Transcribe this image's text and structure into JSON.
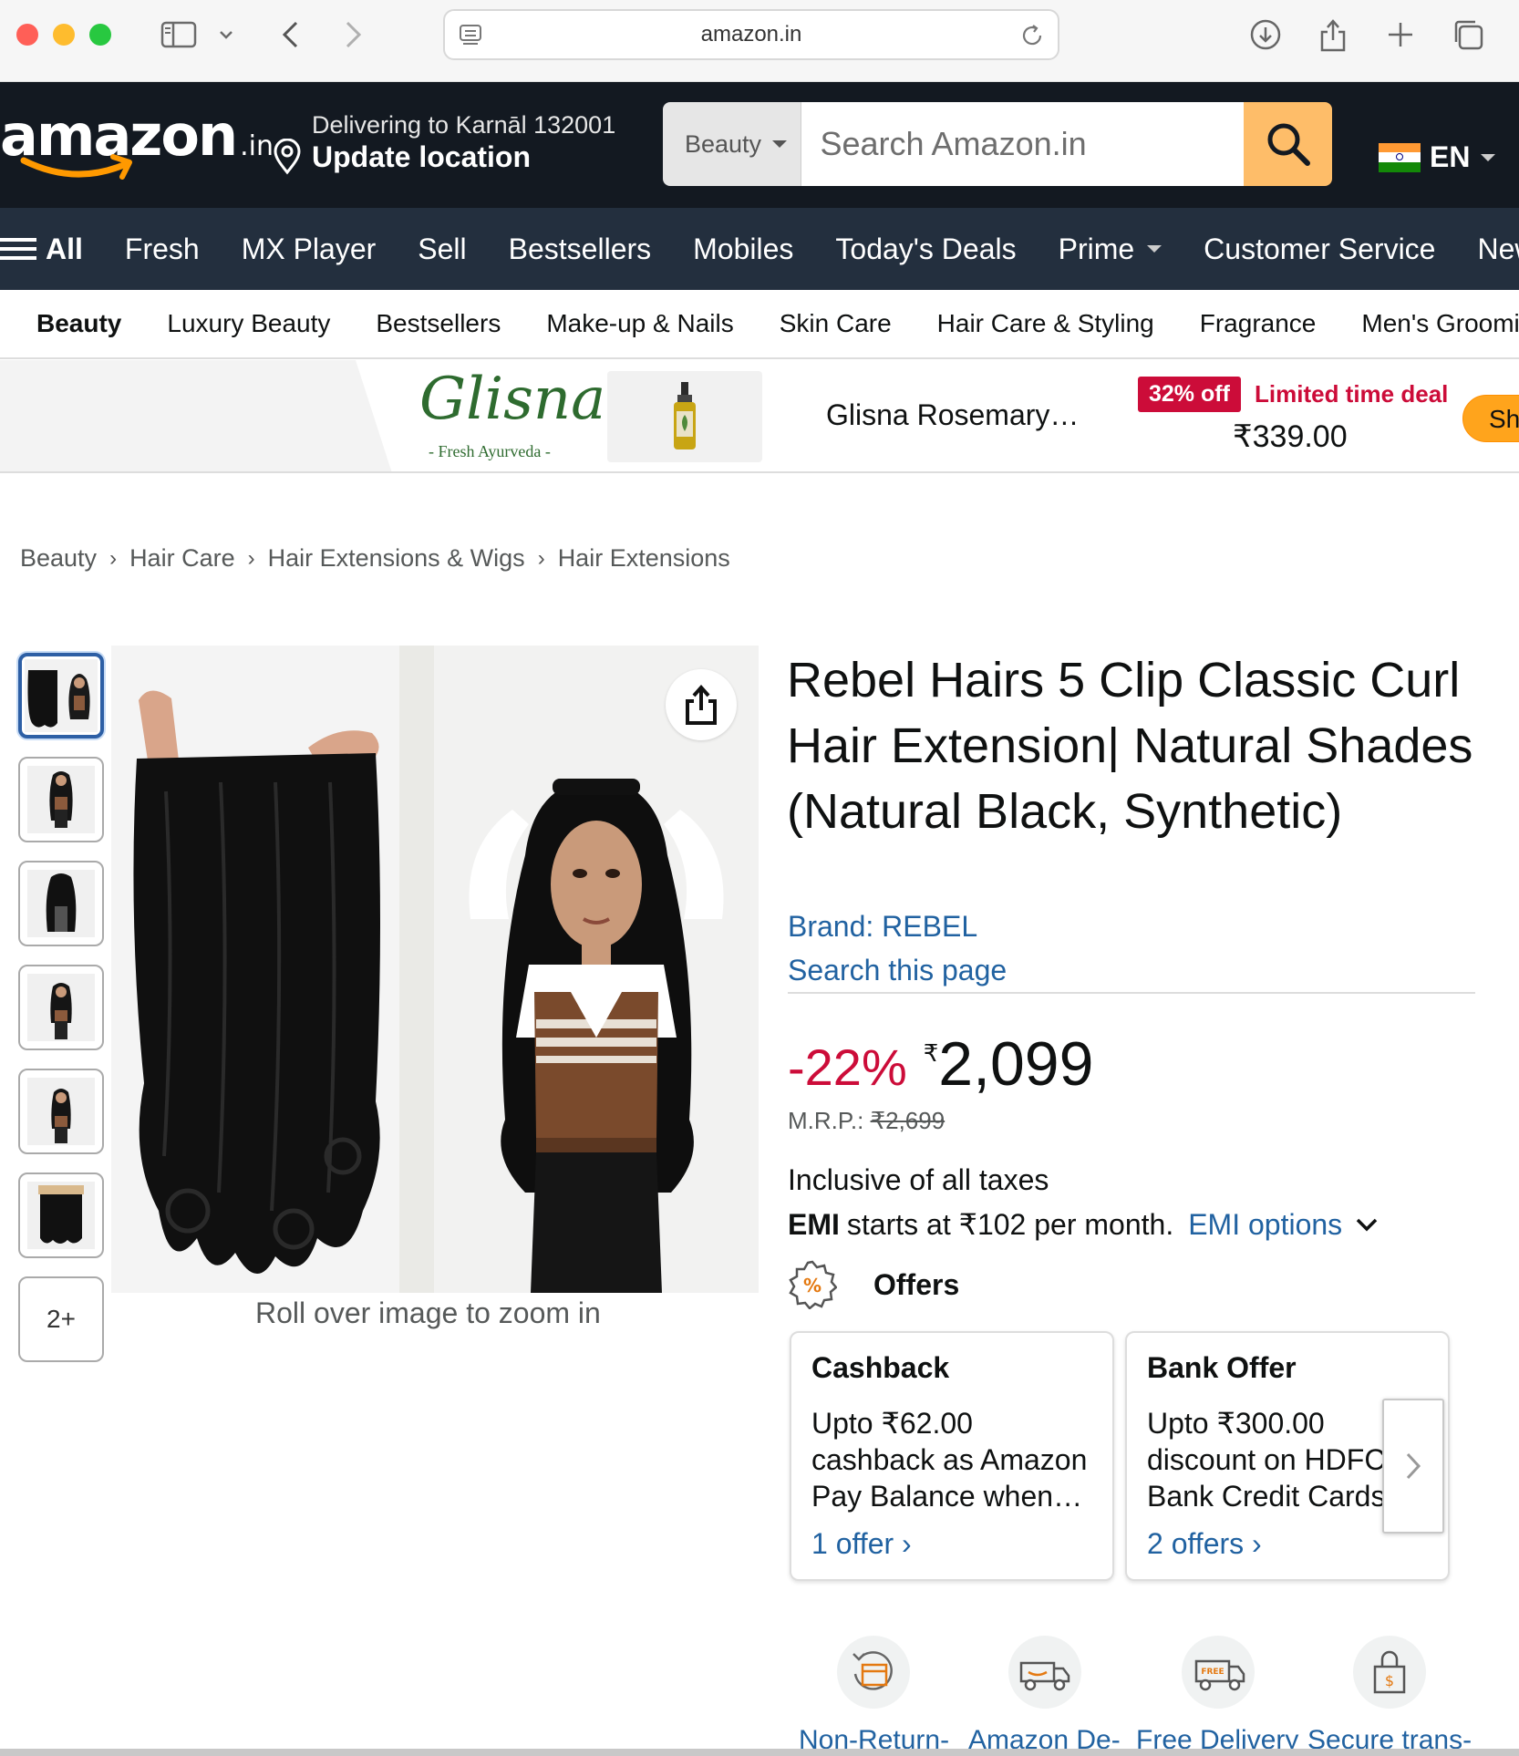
{
  "browser": {
    "url": "amazon.in"
  },
  "header": {
    "logo_main": "amazon",
    "logo_tld": ".in",
    "deliver_line1": "Delivering to Karnāl 132001",
    "deliver_line2": "Update location",
    "search_category": "Beauty",
    "search_placeholder": "Search Amazon.in",
    "language": "EN"
  },
  "nav": {
    "all": "All",
    "items": [
      "Fresh",
      "MX Player",
      "Sell",
      "Bestsellers",
      "Mobiles",
      "Today's Deals",
      "Prime",
      "Customer Service",
      "New"
    ]
  },
  "subnav": {
    "items": [
      "Beauty",
      "Luxury Beauty",
      "Bestsellers",
      "Make-up & Nails",
      "Skin Care",
      "Hair Care & Styling",
      "Fragrance",
      "Men's Groomin"
    ]
  },
  "promo": {
    "brand": "Glisna",
    "brand_tagline": "- Fresh Ayurveda -",
    "product_name": "Glisna Rosemary…",
    "discount_badge": "32% off",
    "deal_label": "Limited time deal",
    "price": "₹339.00",
    "shop_label": "Sho"
  },
  "breadcrumb": [
    "Beauty",
    "Hair Care",
    "Hair Extensions & Wigs",
    "Hair Extensions"
  ],
  "gallery": {
    "more_label": "2+",
    "zoom_hint": "Roll over image to zoom in"
  },
  "product": {
    "title": "Rebel Hairs 5 Clip Classic Curl Hair Extension| Natural Shades (Natural Black, Synthetic)",
    "brand": "Brand: REBEL",
    "search_page": "Search this page",
    "discount": "-22%",
    "currency": "₹",
    "price": "2,099",
    "mrp_label": "M.R.P.:",
    "mrp_value": "₹2,699",
    "taxes": "Inclusive of all taxes",
    "emi_bold": "EMI",
    "emi_text": "starts at ₹102 per month.",
    "emi_link": "EMI options",
    "offers_label": "Offers"
  },
  "offers": [
    {
      "heading": "Cashback",
      "body": "Upto ₹62.00 cashback as Amazon Pay Balance when…",
      "link": "1 offer ›"
    },
    {
      "heading": "Bank Offer",
      "body": "Upto ₹300.00 discount on HDFC Bank Credit Cards",
      "link": "2 offers ›"
    }
  ],
  "features": [
    "Non-Return-",
    "Amazon De-",
    "Free Delivery",
    "Secure trans-"
  ],
  "colors": {
    "nav_dark": "#131921",
    "nav_main": "#232f3e",
    "search_button": "#febd69",
    "link": "#2162a1",
    "deal_red": "#cc0c39",
    "smile": "#ff9900"
  }
}
